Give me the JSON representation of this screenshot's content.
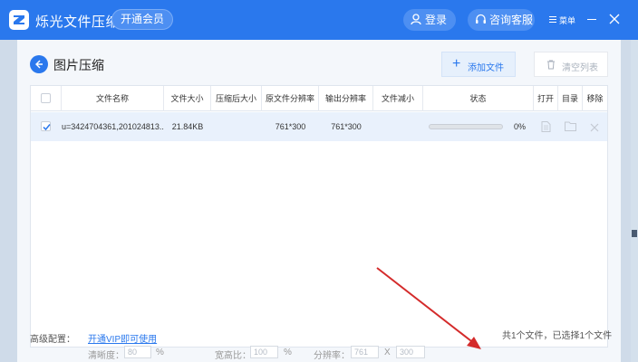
{
  "titlebar": {
    "app_title": "烁光文件压缩",
    "vip_button": "开通会员",
    "login_button": "登录",
    "service_button": "咨询客服",
    "menu_button": "菜单"
  },
  "page": {
    "title": "图片压缩",
    "add_file_button": "添加文件",
    "clear_list_button": "清空列表"
  },
  "table": {
    "headers": [
      "文件名称",
      "文件大小",
      "压缩后大小",
      "原文件分辨率",
      "输出分辨率",
      "文件减小",
      "状态",
      "打开",
      "目录",
      "移除"
    ],
    "rows": [
      {
        "checked": true,
        "name": "u=3424704361,201024813...",
        "size": "21.84KB",
        "compressed_size": "",
        "source_resolution": "761*300",
        "output_resolution": "761*300",
        "reduced": "",
        "progress": 0,
        "progress_text": "0%"
      }
    ]
  },
  "footer": {
    "summary": "共1个文件，已选择1个文件",
    "advanced_label": "高级配置：",
    "vip_link": "开通VIP即可使用",
    "clarity_label": "清晰度：",
    "clarity_value": "80",
    "clarity_unit": "%",
    "aspect_label": "宽高比：",
    "aspect_value": "100",
    "aspect_unit": "%",
    "resolution_label": "分辨率：",
    "resolution_w": "761",
    "resolution_x": "X",
    "resolution_h": "300"
  },
  "colors": {
    "brand": "#2a78ed",
    "selected_row": "#e9f1fc",
    "annotation_arrow": "#d42b2b"
  },
  "icons": [
    "app-logo-icon",
    "user-icon",
    "headset-icon",
    "menu-icon",
    "minimize-icon",
    "close-icon",
    "back-arrow-icon",
    "plus-icon",
    "trash-icon",
    "check-icon",
    "file-icon",
    "folder-icon",
    "remove-x-icon"
  ]
}
